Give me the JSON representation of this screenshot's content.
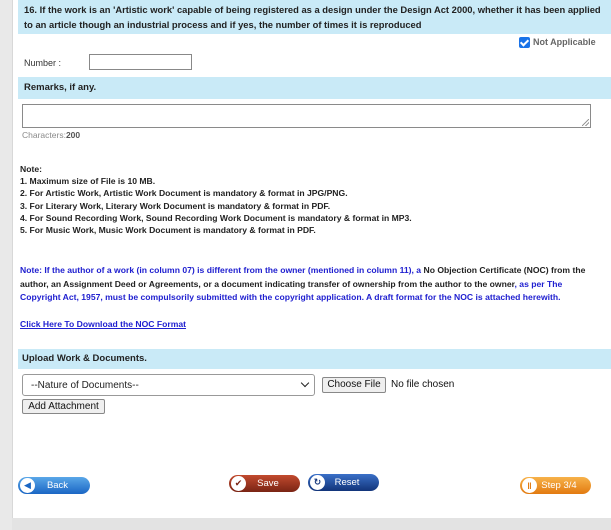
{
  "question": {
    "text": "16. If the work is an 'Artistic work' capable of being registered as a design under the Design Act 2000, whether it has been applied to an article though an industrial process and if yes, the number of times it is reproduced",
    "not_applicable_label": "Not Applicable",
    "not_applicable_checked": true,
    "number_label": "Number :",
    "number_value": ""
  },
  "remarks": {
    "header": "Remarks, if any.",
    "value": "",
    "characters_label": "Characters:",
    "characters_count": "200"
  },
  "notes": {
    "title": "Note:",
    "items": [
      "1. Maximum size of File is 10 MB.",
      "2. For Artistic Work, Artistic Work Document is mandatory & format in JPG/PNG.",
      "3. For Literary Work, Literary Work Document is mandatory & format in PDF.",
      "4. For Sound Recording Work, Sound Recording Work Document is mandatory & format in MP3.",
      "5. For Music Work, Music Work Document is mandatory & format in PDF."
    ]
  },
  "noc": {
    "part1": "Note:",
    "part2": " If the author of a work (in column 07) is different from the owner (mentioned in column 11), a ",
    "part3": "No Objection Certificate (NOC) from the author, an Assignment Deed or Agreements, or a document indicating transfer of ownership from the author to the owner",
    "part4": ", as per The Copyright Act, 1957, must be compulsorily submitted with the copyright application. A draft format for the NOC is attached herewith.",
    "link": "Click Here To Download the NOC Format"
  },
  "upload": {
    "header": "Upload Work & Documents.",
    "select_value": "--Nature of Documents--",
    "choose_file_label": "Choose File",
    "no_file_label": "No file chosen",
    "add_attachment_label": "Add Attachment"
  },
  "buttons": {
    "back": "Back",
    "save": "Save",
    "reset": "Reset",
    "step": "Step 3/4"
  },
  "colors": {
    "section_header_bg": "#c9eaf7",
    "link_blue": "#2020d0",
    "back_button": "#1a66c4",
    "save_button": "#7a2414",
    "reset_button": "#12347a",
    "step_button": "#e27a10"
  }
}
